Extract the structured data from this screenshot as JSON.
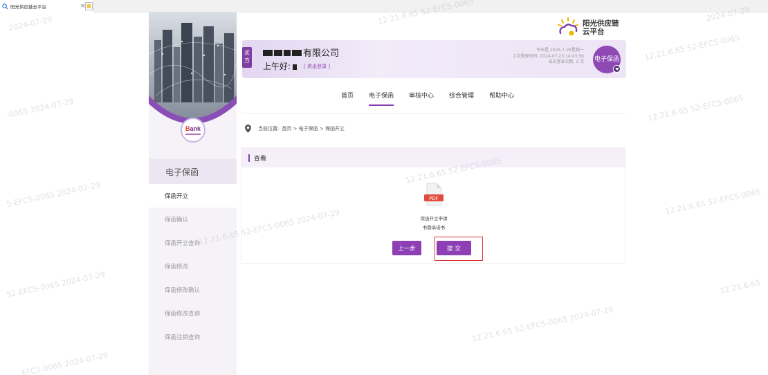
{
  "browser": {
    "tab_title": "阳光供应链云平台",
    "tab_close": "×"
  },
  "watermark": {
    "texts": [
      "2024-07-29",
      "12.21.6.65 52-EFC5-0065",
      "2024-07-29",
      "12.21.6.65 52-EFC5-0065",
      "-0065  2024-07-29",
      "12.21.6.65 52-EFC5-0065",
      "5-EFC5-0065  2024-07-29",
      "12.21.6.65 52-EFC5-0065",
      "52-EFC5-0065  2024-07-29",
      "12.21.6.65 52-EFC5-0065  2024-07-29",
      "12.21.6.65 52-EFC5-0065",
      "EFC5-0065  2024-07-29",
      "12.21.6.65 52-EFC5-0065  2024-07-29",
      "12.21.6.65"
    ]
  },
  "brand": {
    "name_line1": "阳光供应链",
    "name_line2": "云平台"
  },
  "user": {
    "role_badge": "买方",
    "company_suffix": "有限公司",
    "greeting": "上午好:",
    "logout": "[ 退出登录 ]",
    "today": "今天是 2024-7-29星期一",
    "last_login": "上次登录时间: 2024-07-23 14:43:56",
    "login_count": "当天登录次数: 1 次",
    "avatar_label": "电子保函"
  },
  "nav": {
    "items": [
      "首页",
      "电子保函",
      "审核中心",
      "综合管理",
      "帮助中心"
    ],
    "active": "电子保函"
  },
  "breadcrumb": {
    "label": "当前位置:",
    "path": "首页 > 电子保函 > 保函开立"
  },
  "sidebar": {
    "bank_logo_text": "ank",
    "bank_logo_letter": "B",
    "title": "电子保函",
    "items": [
      "保函开立",
      "保函确认",
      "保函开立查询",
      "保函修改",
      "保函修改确认",
      "保函修改查询",
      "保函注销查询"
    ],
    "active": "保函开立"
  },
  "panel": {
    "title": "查看",
    "file_badge": "PDF",
    "file_name_line1": "保函开立申请",
    "file_name_line2": "书暨承诺书",
    "prev_button": "上一步",
    "submit_button": "提 交"
  },
  "colors": {
    "accent": "#8a3fb0",
    "highlight_outline": "#e03434",
    "pdf_red": "#e24b3b"
  }
}
